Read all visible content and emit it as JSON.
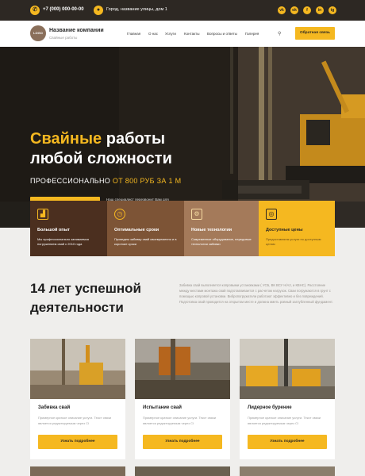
{
  "topbar": {
    "phone": "+7 (000) 000-00-00",
    "address": "Город, название улицы, дом 1",
    "social": [
      "vk",
      "ok",
      "fb",
      "in",
      "tg"
    ]
  },
  "header": {
    "logo_text": "LOGO",
    "brand": "Название компании",
    "brand_sub": "Свайные работы",
    "nav": [
      "Главная",
      "О нас",
      "Услуги",
      "Контакты",
      "Вопросы и ответы",
      "Галерея"
    ],
    "cta": "Обратная связь"
  },
  "hero": {
    "title_accent": "Свайные",
    "title_rest": " работы",
    "title_line2": "любой сложности",
    "sub_plain": "ПРОФЕССИОНАЛЬНО ",
    "sub_accent": "ОТ 800 РУБ ЗА 1 М",
    "button": "Получить консультацию",
    "note": "Наш специалист перезвонит Вам для уточнения деталей и стоимости"
  },
  "features": [
    {
      "icon": "chart-icon",
      "title": "Большой опыт",
      "text": "Мы профессионально занимаемся погружением свай с 2010 года",
      "bg": "#4b2f1f",
      "fg": "#ffffff"
    },
    {
      "icon": "clock-icon",
      "title": "Оптимальные сроки",
      "text": "Проведем забивку свай своевременно и в короткие сроки",
      "bg": "#7d5436",
      "fg": "#ffffff"
    },
    {
      "icon": "gear-icon",
      "title": "Новые технологии",
      "text": "Современное оборудование, передовые технологии забивки",
      "bg": "#a47a5a",
      "fg": "#ffffff"
    },
    {
      "icon": "coins-icon",
      "title": "Доступные цены",
      "text": "Предоставляем услуги по доступным ценам",
      "bg": "#f5b820",
      "fg": "#2d2823"
    }
  ],
  "about": {
    "title_line1": "14 лет успешной",
    "title_line2": "деятельности",
    "text": "Забивка свай выполняется копровыми установками ( УСБ, ВК ВСУ Н/А2, и КВНС). Расстояние между местами монтажа свай подготавливается с расчетом нагрузок. Сваи погружаются в грунт с помощью копровой установки. Вибропогружатели работают эффективно и без повреждений. Подготовка свай проводится на открытом месте и должна иметь ровный заглубленный фундамент."
  },
  "services": [
    {
      "title": "Забивка свай",
      "text": "Примерное краткое описание услуги. Текст связи является редактируемым через CI",
      "button": "Узнать подробнее"
    },
    {
      "title": "Испытание свай",
      "text": "Примерное краткое описание услуги. Текст связи является редактируемым через CI",
      "button": "Узнать подробнее"
    },
    {
      "title": "Лидерное бурение",
      "text": "Примерное краткое описание услуги. Текст связи является редактируемым через CI",
      "button": "Узнать подробнее"
    }
  ],
  "colors": {
    "accent": "#f5b820",
    "dark": "#2d2823"
  }
}
